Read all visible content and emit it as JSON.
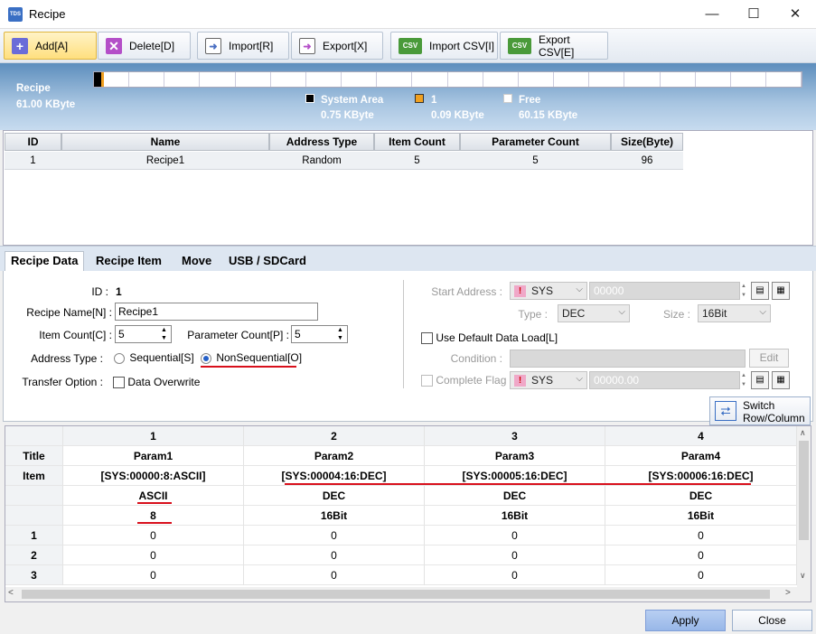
{
  "window": {
    "title": "Recipe",
    "icon": "TDS",
    "controls": {
      "minimize": "—",
      "maximize": "☐",
      "close": "✕"
    }
  },
  "toolbar": {
    "add": "Add[A]",
    "delete": "Delete[D]",
    "import": "Import[R]",
    "export": "Export[X]",
    "import_csv": "Import CSV[I]",
    "export_csv": "Export CSV[E]",
    "csv_icon": "CSV"
  },
  "memory": {
    "label": "Recipe",
    "total": "61.00 KByte",
    "legend": [
      {
        "name": "System Area",
        "size": "0.75 KByte",
        "color": "#000000"
      },
      {
        "name": "1",
        "size": "0.09 KByte",
        "color": "#f0a020"
      },
      {
        "name": "Free",
        "size": "60.15 KByte",
        "color": "#ffffff"
      }
    ]
  },
  "recipe_list": {
    "columns": [
      "ID",
      "Name",
      "Address Type",
      "Item Count",
      "Parameter Count",
      "Size(Byte)"
    ],
    "rows": [
      [
        "1",
        "Recipe1",
        "Random",
        "5",
        "5",
        "96"
      ]
    ]
  },
  "tabs": [
    "Recipe Data",
    "Recipe Item",
    "Move",
    "USB / SDCard"
  ],
  "form": {
    "id_label": "ID :",
    "id_value": "1",
    "name_label": "Recipe Name[N] :",
    "name_value": "Recipe1",
    "item_count_label": "Item Count[C] :",
    "item_count_value": "5",
    "param_count_label": "Parameter Count[P] :",
    "param_count_value": "5",
    "address_type_label": "Address Type :",
    "sequential": "Sequential[S]",
    "nonsequential": "NonSequential[O]",
    "transfer_label": "Transfer Option :",
    "data_overwrite": "Data Overwrite"
  },
  "right": {
    "start_address_label": "Start Address :",
    "device": "SYS",
    "device_badge": "!",
    "address_value": "00000",
    "type_label": "Type :",
    "type_value": "DEC",
    "size_label": "Size :",
    "size_value": "16Bit",
    "default_load": "Use Default Data Load[L]",
    "condition_label": "Condition :",
    "edit": "Edit",
    "complete_flag": "Complete Flag :",
    "flag_value": "00000.00",
    "switch": "Switch",
    "switch2": "Row/Column"
  },
  "grid": {
    "columns": [
      "1",
      "2",
      "3",
      "4"
    ],
    "rows": [
      {
        "label": "Title",
        "cells": [
          "Param1",
          "Param2",
          "Param3",
          "Param4"
        ]
      },
      {
        "label": "Item",
        "cells": [
          "[SYS:00000:8:ASCII]",
          "[SYS:00004:16:DEC]",
          "[SYS:00005:16:DEC]",
          "[SYS:00006:16:DEC]"
        ]
      },
      {
        "label": "",
        "cells": [
          "ASCII",
          "DEC",
          "DEC",
          "DEC"
        ]
      },
      {
        "label": "",
        "cells": [
          "8",
          "16Bit",
          "16Bit",
          "16Bit"
        ]
      },
      {
        "label": "1",
        "cells": [
          "0",
          "0",
          "0",
          "0"
        ]
      },
      {
        "label": "2",
        "cells": [
          "0",
          "0",
          "0",
          "0"
        ]
      },
      {
        "label": "3",
        "cells": [
          "0",
          "0",
          "0",
          "0"
        ]
      }
    ]
  },
  "footer": {
    "apply": "Apply",
    "close": "Close"
  }
}
